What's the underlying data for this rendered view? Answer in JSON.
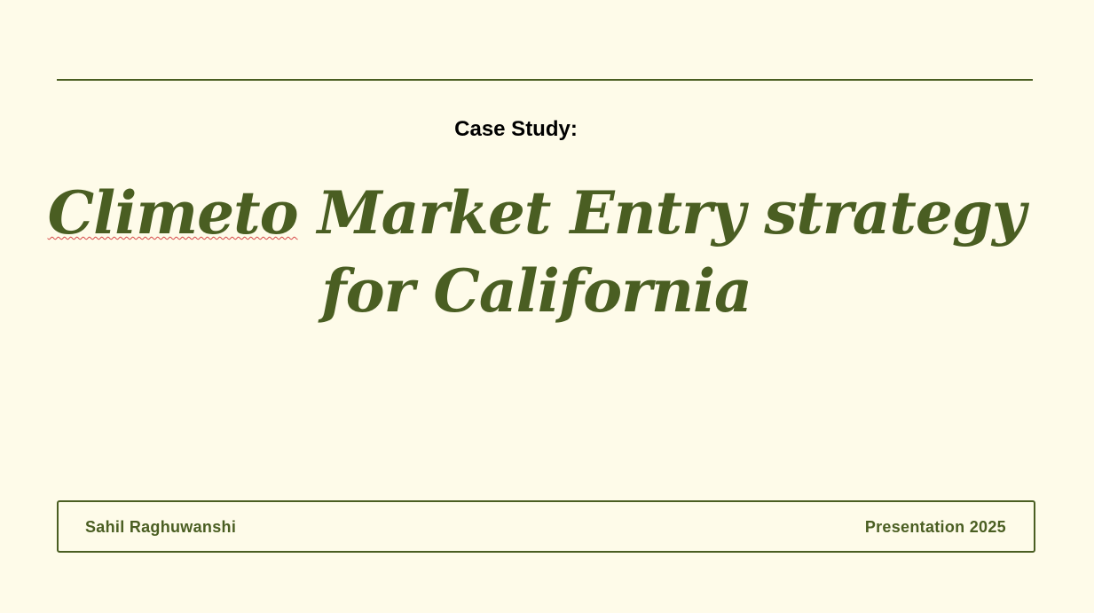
{
  "slide": {
    "subtitle": "Case Study:",
    "title_part1": "Climeto",
    "title_part2": " Market Entry strategy for California",
    "author": "Sahil Raghuwanshi",
    "presentation_label": "Presentation 2025"
  },
  "colors": {
    "background": "#fefbe9",
    "accent": "#4a5e22",
    "subtitle_text": "#000000",
    "spellcheck_underline": "#d64545"
  }
}
